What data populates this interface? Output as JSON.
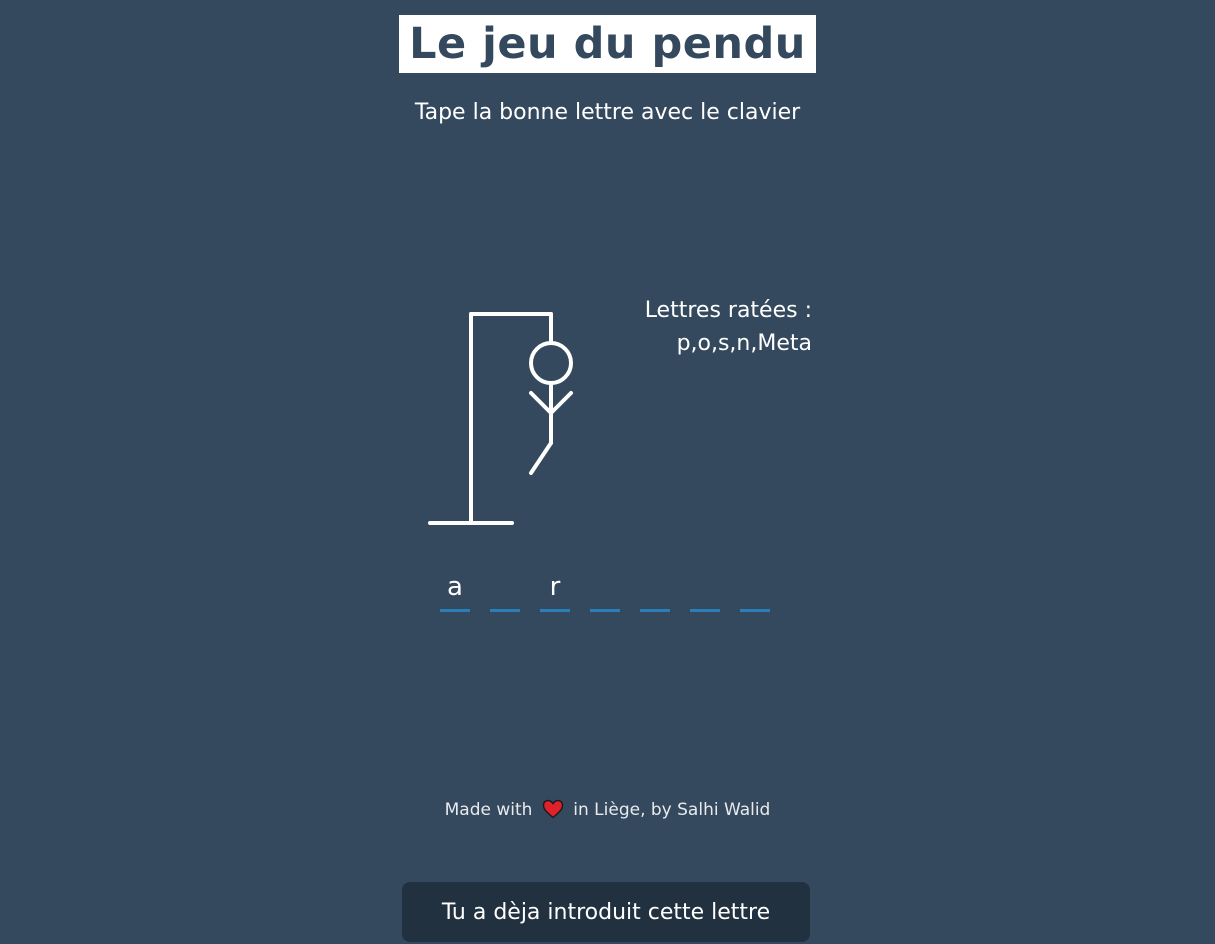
{
  "header": {
    "title": "Le jeu du pendu",
    "subtitle": "Tape la bonne lettre avec le clavier"
  },
  "wrong_letters": {
    "label": "Lettres ratées :",
    "value": "p,o,s,n,Meta"
  },
  "word_slots": [
    "a",
    "",
    "r",
    "",
    "",
    "",
    ""
  ],
  "footer": {
    "before": "Made with",
    "after": "in Liège, by Salhi Walid",
    "icon": "heart-icon"
  },
  "notification": {
    "text": "Tu a dèja introduit cette lettre"
  },
  "colors": {
    "background": "#34495e",
    "title_text": "#34495e",
    "slot_underline": "#2980b9",
    "heart": "#e0202a",
    "notification_bg": "#22313f"
  }
}
